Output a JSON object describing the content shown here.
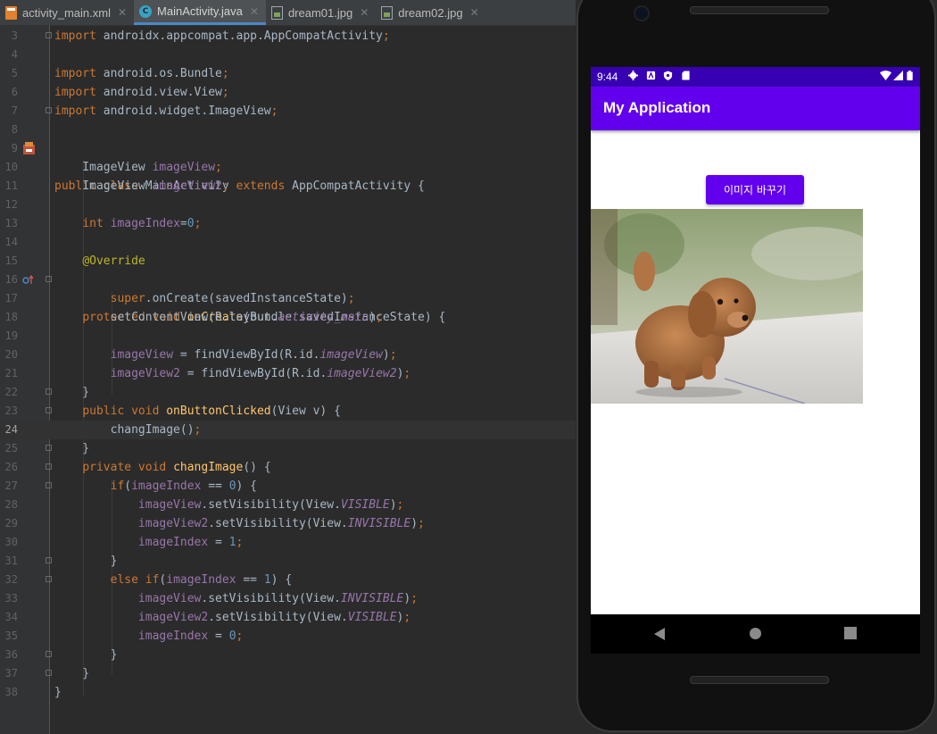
{
  "tabs": [
    {
      "label": "activity_main.xml",
      "icon": "xml-file-icon",
      "active": false
    },
    {
      "label": "MainActivity.java",
      "icon": "java-class-icon",
      "active": true
    },
    {
      "label": "dream01.jpg",
      "icon": "image-file-icon",
      "active": false
    },
    {
      "label": "dream02.jpg",
      "icon": "image-file-icon",
      "active": false
    }
  ],
  "editor": {
    "current_line": 24,
    "line_numbers": [
      "3",
      "4",
      "5",
      "6",
      "7",
      "8",
      "9",
      "10",
      "11",
      "12",
      "13",
      "14",
      "15",
      "16",
      "17",
      "18",
      "19",
      "20",
      "21",
      "22",
      "23",
      "24",
      "25",
      "26",
      "27",
      "28",
      "29",
      "30",
      "31",
      "32",
      "33",
      "34",
      "35",
      "36",
      "37",
      "38"
    ]
  },
  "phone": {
    "status": {
      "time": "9:44"
    },
    "app_title": "My Application",
    "button_label": "이미지 바꾸기",
    "image_subject": "brown-toy-poodle-puppy"
  },
  "colors": {
    "primary": "#6200ee",
    "primary_dark": "#3700b3",
    "editor_bg": "#2b2b2b",
    "keyword": "#cc7832",
    "method": "#ffc66d",
    "field": "#9876aa",
    "number": "#6897bb",
    "annotation": "#bbb529"
  }
}
